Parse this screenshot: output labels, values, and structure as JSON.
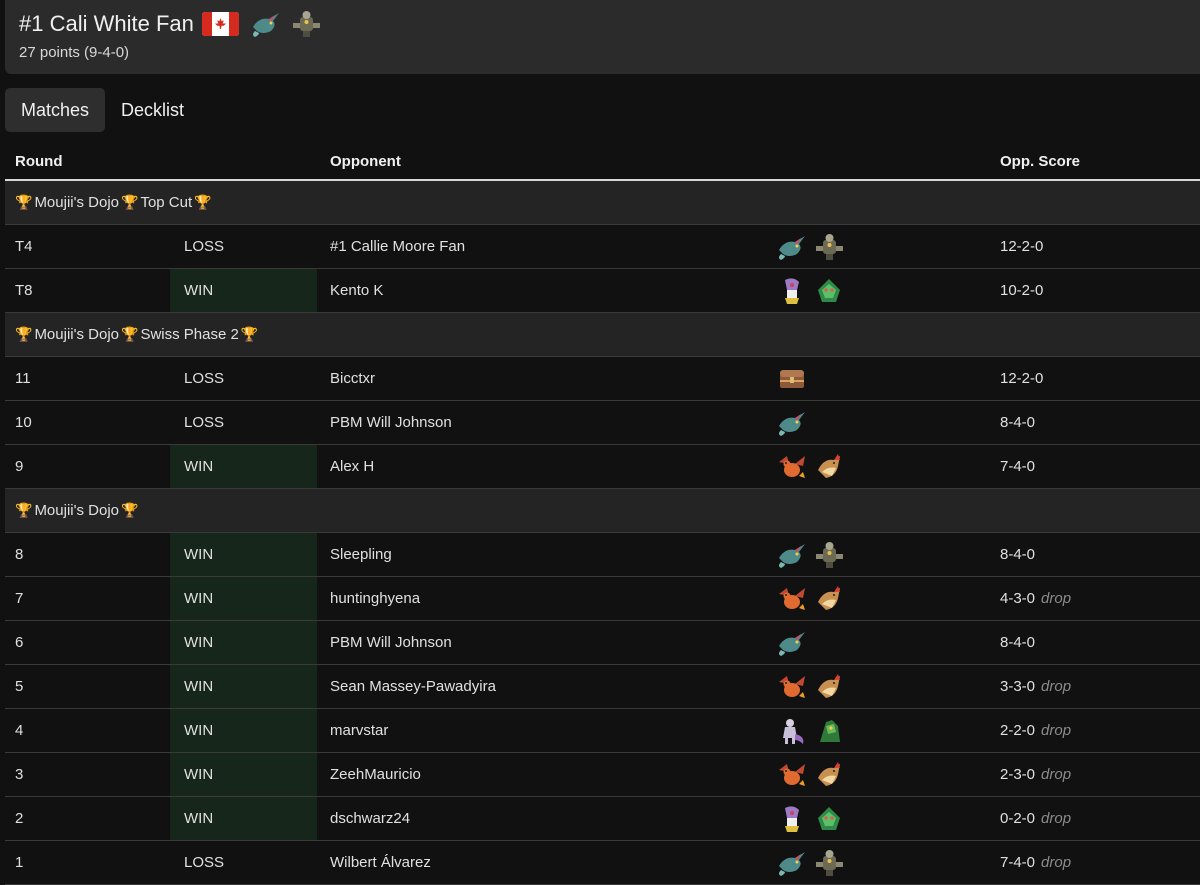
{
  "header": {
    "player_name": "#1 Cali White Fan",
    "record": "27 points (9-4-0)",
    "flag": "canada-flag",
    "deck_icons": [
      "dragapult-sprite",
      "dusknoir-sprite"
    ]
  },
  "tabs": [
    {
      "label": "Matches",
      "active": true
    },
    {
      "label": "Decklist",
      "active": false
    }
  ],
  "columns": {
    "round": "Round",
    "opponent": "Opponent",
    "score": "Opp. Score"
  },
  "sections": [
    {
      "label_parts": [
        "Moujii's Dojo",
        "Top Cut"
      ],
      "rows": [
        {
          "round": "T4",
          "result": "LOSS",
          "opponent": "#1 Callie Moore Fan",
          "deck": [
            "dragapult",
            "dusknoir"
          ],
          "score": "12-2-0",
          "drop": ""
        },
        {
          "round": "T8",
          "result": "WIN",
          "opponent": "Kento K",
          "deck": [
            "gardevoir",
            "grass"
          ],
          "score": "10-2-0",
          "drop": ""
        }
      ]
    },
    {
      "label_parts": [
        "Moujii's Dojo",
        "Swiss Phase 2"
      ],
      "rows": [
        {
          "round": "11",
          "result": "LOSS",
          "opponent": "Bicctxr",
          "deck": [
            "chest"
          ],
          "score": "12-2-0",
          "drop": ""
        },
        {
          "round": "10",
          "result": "LOSS",
          "opponent": "PBM Will Johnson",
          "deck": [
            "dragapult"
          ],
          "score": "8-4-0",
          "drop": ""
        },
        {
          "round": "9",
          "result": "WIN",
          "opponent": "Alex H",
          "deck": [
            "charizard",
            "pidgeot"
          ],
          "score": "7-4-0",
          "drop": ""
        }
      ]
    },
    {
      "label_parts": [
        "Moujii's Dojo"
      ],
      "rows": [
        {
          "round": "8",
          "result": "WIN",
          "opponent": "Sleepling",
          "deck": [
            "dragapult",
            "dusknoir"
          ],
          "score": "8-4-0",
          "drop": ""
        },
        {
          "round": "7",
          "result": "WIN",
          "opponent": "huntinghyena",
          "deck": [
            "charizard",
            "pidgeot"
          ],
          "score": "4-3-0",
          "drop": "drop"
        },
        {
          "round": "6",
          "result": "WIN",
          "opponent": "PBM Will Johnson",
          "deck": [
            "dragapult"
          ],
          "score": "8-4-0",
          "drop": ""
        },
        {
          "round": "5",
          "result": "WIN",
          "opponent": "Sean Massey-Pawadyira",
          "deck": [
            "charizard",
            "pidgeot"
          ],
          "score": "3-3-0",
          "drop": "drop"
        },
        {
          "round": "4",
          "result": "WIN",
          "opponent": "marvstar",
          "deck": [
            "mewtwo",
            "grass2"
          ],
          "score": "2-2-0",
          "drop": "drop"
        },
        {
          "round": "3",
          "result": "WIN",
          "opponent": "ZeehMauricio",
          "deck": [
            "charizard",
            "pidgeot"
          ],
          "score": "2-3-0",
          "drop": "drop"
        },
        {
          "round": "2",
          "result": "WIN",
          "opponent": "dschwarz24",
          "deck": [
            "gardevoir",
            "grass"
          ],
          "score": "0-2-0",
          "drop": "drop"
        },
        {
          "round": "1",
          "result": "LOSS",
          "opponent": "Wilbert Álvarez",
          "deck": [
            "dragapult",
            "dusknoir"
          ],
          "score": "7-4-0",
          "drop": "drop"
        }
      ]
    }
  ],
  "colors": {
    "background": "#111111",
    "win_cell": "#16261a",
    "trophy": "#e9b51c"
  }
}
